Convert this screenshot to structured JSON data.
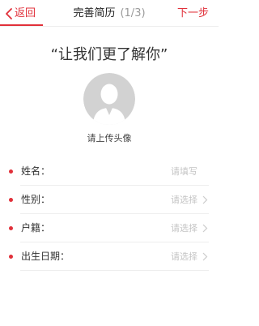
{
  "nav": {
    "back_label": "返回",
    "title": "完善简历",
    "step": "(1/3)",
    "next_label": "下一步"
  },
  "headline": "“让我们更了解你”",
  "avatar": {
    "hint": "请上传头像"
  },
  "form": {
    "fields": [
      {
        "label": "姓名：",
        "placeholder": "请填写",
        "required": true,
        "arrow": false
      },
      {
        "label": "性别：",
        "placeholder": "请选择",
        "required": true,
        "arrow": true
      },
      {
        "label": "户籍：",
        "placeholder": "请选择",
        "required": true,
        "arrow": true
      },
      {
        "label": "出生日期：",
        "placeholder": "请选择",
        "required": true,
        "arrow": true
      }
    ]
  },
  "colors": {
    "accent": "#e1303a",
    "placeholder": "#c4c4c4",
    "avatar_bg": "#d2d2d2"
  },
  "icons": {
    "back": "chevron-left-icon",
    "avatar": "user-silhouette-icon",
    "arrow": "chevron-right-icon"
  }
}
